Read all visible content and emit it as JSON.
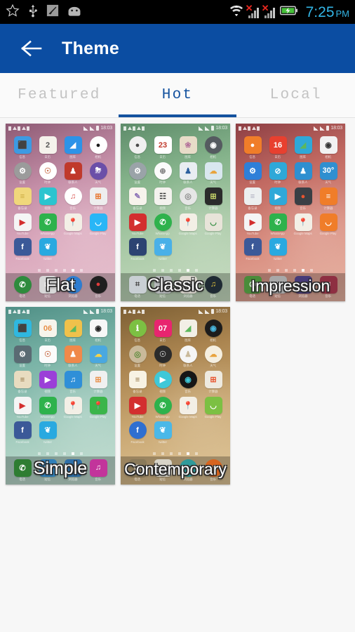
{
  "statusbar": {
    "icons": [
      "star-outline-icon",
      "usb-icon",
      "adb-debug-icon",
      "android-head-icon"
    ],
    "wifi": "wifi-icon",
    "signal1": {
      "icon": "signal-bars-icon",
      "x_mark": "✕"
    },
    "signal2": {
      "icon": "signal-bars-icon",
      "x_mark": "✕"
    },
    "battery": "battery-charging-icon",
    "time": "7:25",
    "ampm": "PM",
    "clock_color": "#33b5e5",
    "bg_color": "#000000"
  },
  "header": {
    "back_icon": "arrow-left-icon",
    "title": "Theme",
    "bg_color": "#0b4da2"
  },
  "tabs": {
    "active_index": 1,
    "accent_color": "#14529f",
    "inactive_color": "#c3c3c3",
    "items": [
      {
        "label": "Featured"
      },
      {
        "label": "Hot"
      },
      {
        "label": "Local"
      }
    ]
  },
  "preview_common": {
    "status_time": "18:03",
    "dots_count": 6,
    "dots_active_index": 4,
    "app_labels": [
      "信息",
      "日历",
      "图库",
      "相机",
      "设置",
      "时钟",
      "联系人",
      "天气",
      "备忘录",
      "视频",
      "音乐",
      "计算器",
      "YouTube",
      "WhatsApp",
      "Google Maps",
      "Google Play",
      "Facebook",
      "twitter"
    ],
    "dock_labels": [
      "电话",
      "短信",
      "浏览器",
      "音乐"
    ]
  },
  "themes": [
    {
      "name": "Flat",
      "bg_class": "bg-flat",
      "icons": [
        {
          "label": "信息",
          "color": "#3d9ae3",
          "glyph": "⬛",
          "shape": "sq"
        },
        {
          "label": "日历",
          "color": "#f5f2ec",
          "glyph": "2",
          "shape": "sq",
          "fg": "#555"
        },
        {
          "label": "图库",
          "color": "#2c93e8",
          "glyph": "◢",
          "shape": "sq"
        },
        {
          "label": "相机",
          "color": "#ffffff",
          "glyph": "●",
          "shape": "circ",
          "fg": "#1a1a1a"
        },
        {
          "label": "设置",
          "color": "#9b9b9b",
          "glyph": "⚙",
          "shape": "circ"
        },
        {
          "label": "时钟",
          "color": "#ffffff",
          "glyph": "☉",
          "shape": "circ",
          "fg": "#c75"
        },
        {
          "label": "联系人",
          "color": "#c0392b",
          "glyph": "♟",
          "shape": "sq"
        },
        {
          "label": "天气",
          "color": "#6b4fa8",
          "glyph": "⛈",
          "shape": "circ"
        },
        {
          "label": "备忘录",
          "color": "#f0d77b",
          "glyph": "≡",
          "shape": "sq",
          "fg": "#c9a93f"
        },
        {
          "label": "视频",
          "color": "#2bc4cf",
          "glyph": "▶",
          "shape": "sq"
        },
        {
          "label": "音乐",
          "color": "#ffffff",
          "glyph": "♫",
          "shape": "circ",
          "fg": "#d9534f"
        },
        {
          "label": "计算器",
          "color": "#eeeeee",
          "glyph": "⊞",
          "shape": "sq",
          "fg": "#e8732a"
        },
        {
          "label": "YouTube",
          "color": "#f5f5f5",
          "glyph": "▶",
          "shape": "sq",
          "fg": "#d32f2f"
        },
        {
          "label": "WhatsApp",
          "color": "#2eb24c",
          "glyph": "✆",
          "shape": "sq"
        },
        {
          "label": "Google Maps",
          "color": "#f3efe6",
          "glyph": "📍",
          "shape": "sq",
          "fg": "#d93025"
        },
        {
          "label": "Google Play",
          "color": "#29b6f6",
          "glyph": "◡",
          "shape": "sq"
        },
        {
          "label": "Facebook",
          "color": "#3b5998",
          "glyph": "f",
          "shape": "sq"
        },
        {
          "label": "twitter",
          "color": "#29a9e0",
          "glyph": "❦",
          "shape": "sq"
        }
      ],
      "dock": [
        {
          "label": "电话",
          "color": "#2e8b3d",
          "glyph": "✆",
          "shape": "circ"
        },
        {
          "label": "短信",
          "color": "#d8d8d8",
          "glyph": "✉",
          "shape": "sq"
        },
        {
          "label": "浏览器",
          "color": "#2e7dd1",
          "glyph": "●",
          "shape": "circ"
        },
        {
          "label": "音乐",
          "color": "#1f1f1f",
          "glyph": "●",
          "shape": "circ",
          "fg": "#e03b3b"
        }
      ]
    },
    {
      "name": "Classic",
      "bg_class": "bg-classic",
      "icons": [
        {
          "label": "信息",
          "color": "#f0f0f0",
          "glyph": "●",
          "shape": "circ",
          "fg": "#4a4a4a"
        },
        {
          "label": "日历",
          "color": "#ffffff",
          "glyph": "23",
          "shape": "sq",
          "fg": "#c0392b"
        },
        {
          "label": "图库",
          "color": "#e8dcc8",
          "glyph": "❀",
          "shape": "sq",
          "fg": "#b5739b"
        },
        {
          "label": "相机",
          "color": "#555b60",
          "glyph": "◉",
          "shape": "circ"
        },
        {
          "label": "设置",
          "color": "#9aa3a8",
          "glyph": "⚙",
          "shape": "circ"
        },
        {
          "label": "时钟",
          "color": "#fbfbfb",
          "glyph": "⊕",
          "shape": "circ",
          "fg": "#777"
        },
        {
          "label": "联系人",
          "color": "#e9edf2",
          "glyph": "♟",
          "shape": "sq",
          "fg": "#2c5f9e"
        },
        {
          "label": "天气",
          "color": "#d9e7ef",
          "glyph": "☁",
          "shape": "sq",
          "fg": "#e8a33d"
        },
        {
          "label": "备忘录",
          "color": "#f7f3ec",
          "glyph": "✎",
          "shape": "sq",
          "fg": "#8a6fb5"
        },
        {
          "label": "视频",
          "color": "#f4f2ee",
          "glyph": "☷",
          "shape": "sq",
          "fg": "#333"
        },
        {
          "label": "音乐",
          "color": "#e6e6e6",
          "glyph": "◎",
          "shape": "circ",
          "fg": "#888"
        },
        {
          "label": "计算器",
          "color": "#2b2b2b",
          "glyph": "⊞",
          "shape": "sq",
          "fg": "#c9d86a"
        },
        {
          "label": "YouTube",
          "color": "#d32f2f",
          "glyph": "▶",
          "shape": "sq"
        },
        {
          "label": "WhatsApp",
          "color": "#2eb24c",
          "glyph": "✆",
          "shape": "circ"
        },
        {
          "label": "Google Maps",
          "color": "#f3efe6",
          "glyph": "📍",
          "shape": "sq",
          "fg": "#d93025"
        },
        {
          "label": "Google Play",
          "color": "#e8e4d9",
          "glyph": "◡",
          "shape": "sq",
          "fg": "#2e8b3d"
        },
        {
          "label": "Facebook",
          "color": "#2c4372",
          "glyph": "f",
          "shape": "sq"
        },
        {
          "label": "twitter",
          "color": "#49b0e8",
          "glyph": "❦",
          "shape": "sq"
        }
      ],
      "dock": [
        {
          "label": "电话",
          "color": "#c9cfd4",
          "glyph": "⌗",
          "shape": "sq",
          "fg": "#444"
        },
        {
          "label": "短信",
          "color": "#b9bcbe",
          "glyph": "✉",
          "shape": "sq",
          "fg": "#555"
        },
        {
          "label": "浏览器",
          "color": "#dedad2",
          "glyph": "☷",
          "shape": "sq",
          "fg": "#555"
        },
        {
          "label": "音乐",
          "color": "#1f2a33",
          "glyph": "♫",
          "shape": "circ",
          "fg": "#e8c83d"
        }
      ]
    },
    {
      "name": "Impression",
      "bg_class": "bg-impression",
      "icons": [
        {
          "label": "信息",
          "color": "#f07d29",
          "glyph": "●",
          "shape": "sq"
        },
        {
          "label": "日历",
          "color": "#e8402f",
          "glyph": "16",
          "shape": "sq"
        },
        {
          "label": "图库",
          "color": "#2fa8d8",
          "glyph": "◢",
          "shape": "sq",
          "fg": "#5cb85c"
        },
        {
          "label": "相机",
          "color": "#f2f2f2",
          "glyph": "◉",
          "shape": "sq",
          "fg": "#333"
        },
        {
          "label": "设置",
          "color": "#2f7fd8",
          "glyph": "⚙",
          "shape": "sq"
        },
        {
          "label": "时钟",
          "color": "#2fa8d8",
          "glyph": "⊘",
          "shape": "sq"
        },
        {
          "label": "联系人",
          "color": "#2f8fd0",
          "glyph": "♟",
          "shape": "sq"
        },
        {
          "label": "天气",
          "color": "#2f8fd0",
          "glyph": "30°",
          "shape": "sq"
        },
        {
          "label": "备忘录",
          "color": "#eceff0",
          "glyph": "≡",
          "shape": "sq",
          "fg": "#aab"
        },
        {
          "label": "视频",
          "color": "#2fa8d8",
          "glyph": "▶",
          "shape": "sq"
        },
        {
          "label": "音乐",
          "color": "#3a3f45",
          "glyph": "●",
          "shape": "sq",
          "fg": "#e8542f"
        },
        {
          "label": "计算器",
          "color": "#f07d29",
          "glyph": "≡",
          "shape": "sq"
        },
        {
          "label": "YouTube",
          "color": "#f5f5f5",
          "glyph": "▶",
          "shape": "sq",
          "fg": "#d32f2f"
        },
        {
          "label": "WhatsApp",
          "color": "#2eb24c",
          "glyph": "✆",
          "shape": "sq"
        },
        {
          "label": "Google Maps",
          "color": "#f3efe6",
          "glyph": "📍",
          "shape": "sq",
          "fg": "#d93025"
        },
        {
          "label": "Google Play",
          "color": "#f07d29",
          "glyph": "◡",
          "shape": "sq"
        },
        {
          "label": "Facebook",
          "color": "#3b5998",
          "glyph": "f",
          "shape": "sq"
        },
        {
          "label": "twitter",
          "color": "#29a9e0",
          "glyph": "❦",
          "shape": "sq"
        }
      ],
      "dock": [
        {
          "label": "电话",
          "color": "#4a8c3a",
          "glyph": "✆",
          "shape": "sq"
        },
        {
          "label": "短信",
          "color": "#a8a8a8",
          "glyph": "✉",
          "shape": "sq"
        },
        {
          "label": "浏览器",
          "color": "#463a78",
          "glyph": "●",
          "shape": "sq"
        },
        {
          "label": "音乐",
          "color": "#8e2f42",
          "glyph": "♫",
          "shape": "sq"
        }
      ]
    },
    {
      "name": "Simple",
      "bg_class": "bg-simple",
      "icons": [
        {
          "label": "信息",
          "color": "#2fb8e0",
          "glyph": "⬛",
          "shape": "sq"
        },
        {
          "label": "日历",
          "color": "#f7f4ec",
          "glyph": "06",
          "shape": "sq",
          "fg": "#e8904a"
        },
        {
          "label": "图库",
          "color": "#f0c14b",
          "glyph": "◢",
          "shape": "sq",
          "fg": "#5cb85c"
        },
        {
          "label": "相机",
          "color": "#f7f7f7",
          "glyph": "◉",
          "shape": "sq",
          "fg": "#222"
        },
        {
          "label": "设置",
          "color": "#5a6b73",
          "glyph": "⚙",
          "shape": "sq"
        },
        {
          "label": "时钟",
          "color": "#fbfbfb",
          "glyph": "☉",
          "shape": "sq",
          "fg": "#c75"
        },
        {
          "label": "联系人",
          "color": "#f0894a",
          "glyph": "♟",
          "shape": "sq"
        },
        {
          "label": "天气",
          "color": "#4aa8e0",
          "glyph": "☁",
          "shape": "sq",
          "fg": "#f5d34a"
        },
        {
          "label": "备忘录",
          "color": "#e8dcc0",
          "glyph": "≡",
          "shape": "sq",
          "fg": "#8a6a3a"
        },
        {
          "label": "视频",
          "color": "#9b3fd8",
          "glyph": "▶",
          "shape": "sq"
        },
        {
          "label": "音乐",
          "color": "#2f8fd8",
          "glyph": "♫",
          "shape": "sq"
        },
        {
          "label": "计算器",
          "color": "#f0f0f0",
          "glyph": "⊞",
          "shape": "sq",
          "fg": "#e8904a"
        },
        {
          "label": "YouTube",
          "color": "#f5f5f5",
          "glyph": "▶",
          "shape": "sq",
          "fg": "#d32f2f"
        },
        {
          "label": "WhatsApp",
          "color": "#2eb24c",
          "glyph": "✆",
          "shape": "sq"
        },
        {
          "label": "Google Maps",
          "color": "#f3efe6",
          "glyph": "📍",
          "shape": "sq",
          "fg": "#d93025"
        },
        {
          "label": "Google Play",
          "color": "#3ab54a",
          "glyph": "📍",
          "shape": "sq"
        },
        {
          "label": "Facebook",
          "color": "#3b5998",
          "glyph": "f",
          "shape": "sq"
        },
        {
          "label": "twitter",
          "color": "#29a9e0",
          "glyph": "❦",
          "shape": "sq"
        }
      ],
      "dock": [
        {
          "label": "电话",
          "color": "#2e7d32",
          "glyph": "✆",
          "shape": "sq"
        },
        {
          "label": "短信",
          "color": "#2f7fb8",
          "glyph": "✉",
          "shape": "sq"
        },
        {
          "label": "浏览器",
          "color": "#2f6fa8",
          "glyph": "●",
          "shape": "sq"
        },
        {
          "label": "音乐",
          "color": "#c2349b",
          "glyph": "♫",
          "shape": "sq"
        }
      ]
    },
    {
      "name": "Contemporary",
      "bg_class": "bg-contemporary",
      "icons": [
        {
          "label": "信息",
          "color": "#7cc043",
          "glyph": "ℹ",
          "shape": "circ"
        },
        {
          "label": "日历",
          "color": "#e8256f",
          "glyph": "07",
          "shape": "sq"
        },
        {
          "label": "图库",
          "color": "#f2efe6",
          "glyph": "◢",
          "shape": "sq",
          "fg": "#5cb85c"
        },
        {
          "label": "相机",
          "color": "#1c1c1c",
          "glyph": "◉",
          "shape": "circ",
          "fg": "#4ab8e0"
        },
        {
          "label": "设置",
          "color": "#c9b99a",
          "glyph": "◎",
          "shape": "circ",
          "fg": "#5a8a3a"
        },
        {
          "label": "时钟",
          "color": "#2b2b2b",
          "glyph": "☉",
          "shape": "circ",
          "fg": "#bbb"
        },
        {
          "label": "联系人",
          "color": "#f5f5f5",
          "glyph": "♟",
          "shape": "circ",
          "fg": "#c9b99a"
        },
        {
          "label": "天气",
          "color": "#f5efe0",
          "glyph": "☁",
          "shape": "circ",
          "fg": "#e8a33d"
        },
        {
          "label": "备忘录",
          "color": "#f7f2e4",
          "glyph": "≡",
          "shape": "sq",
          "fg": "#8a6a3a"
        },
        {
          "label": "视频",
          "color": "#3fc8d8",
          "glyph": "▶",
          "shape": "circ"
        },
        {
          "label": "音乐",
          "color": "#161616",
          "glyph": "◉",
          "shape": "circ",
          "fg": "#3fc8d8"
        },
        {
          "label": "计算器",
          "color": "#eeeae0",
          "glyph": "⊞",
          "shape": "sq",
          "fg": "#e8542f"
        },
        {
          "label": "YouTube",
          "color": "#d32f2f",
          "glyph": "▶",
          "shape": "sq"
        },
        {
          "label": "WhatsApp",
          "color": "#2eb24c",
          "glyph": "✆",
          "shape": "circ"
        },
        {
          "label": "Google Maps",
          "color": "#f3efe6",
          "glyph": "📍",
          "shape": "sq",
          "fg": "#d93025"
        },
        {
          "label": "Google Play",
          "color": "#7cc043",
          "glyph": "◡",
          "shape": "sq"
        },
        {
          "label": "Facebook",
          "color": "#2f6fd0",
          "glyph": "f",
          "shape": "circ"
        },
        {
          "label": "twitter",
          "color": "#4ab8e8",
          "glyph": "❦",
          "shape": "sq"
        }
      ],
      "dock": [
        {
          "label": "电话",
          "color": "#8a7a5a",
          "glyph": "✆",
          "shape": "sq"
        },
        {
          "label": "短信",
          "color": "#d8d4c8",
          "glyph": "✉",
          "shape": "sq",
          "fg": "#666"
        },
        {
          "label": "浏览器",
          "color": "#2f9a9a",
          "glyph": "●",
          "shape": "circ"
        },
        {
          "label": "音乐",
          "color": "#d8641f",
          "glyph": "♫",
          "shape": "circ"
        }
      ]
    }
  ]
}
